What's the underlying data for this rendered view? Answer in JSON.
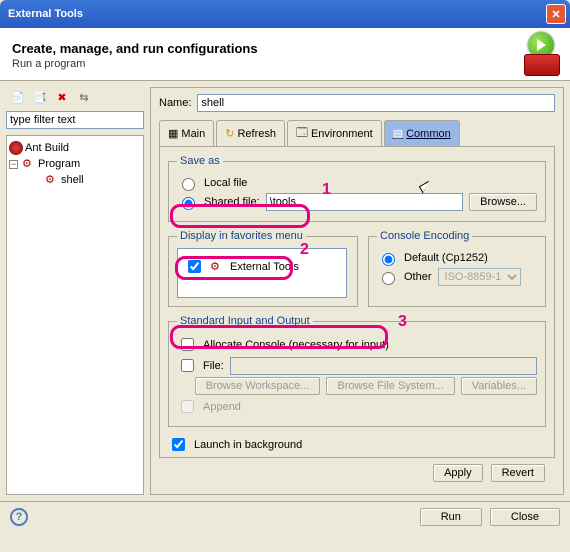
{
  "window": {
    "title": "External Tools"
  },
  "header": {
    "title": "Create, manage, and run configurations",
    "subtitle": "Run a program"
  },
  "left": {
    "filter_placeholder": "type filter text",
    "tree": {
      "ant": "Ant Build",
      "program": "Program",
      "shell": "shell"
    }
  },
  "right": {
    "name_label": "Name:",
    "name_value": "shell",
    "tabs": {
      "main": "Main",
      "refresh": "Refresh",
      "environment": "Environment",
      "common": "Common"
    },
    "saveas": {
      "legend": "Save as",
      "local": "Local file",
      "shared": "Shared file:",
      "shared_value": "\\tools",
      "browse": "Browse..."
    },
    "fav": {
      "legend": "Display in favorites menu",
      "item": "External Tools"
    },
    "enc": {
      "legend": "Console Encoding",
      "default": "Default (Cp1252)",
      "other": "Other",
      "other_value": "ISO-8859-1"
    },
    "io": {
      "legend": "Standard Input and Output",
      "alloc": "Allocate Console (necessary for input)",
      "file": "File:",
      "ws": "Browse Workspace...",
      "fs": "Browse File System...",
      "vars": "Variables...",
      "append": "Append"
    },
    "launch_bg": "Launch in background",
    "apply": "Apply",
    "revert": "Revert"
  },
  "dialog": {
    "run": "Run",
    "close": "Close"
  },
  "ann": {
    "a1": "1",
    "a2": "2",
    "a3": "3"
  }
}
